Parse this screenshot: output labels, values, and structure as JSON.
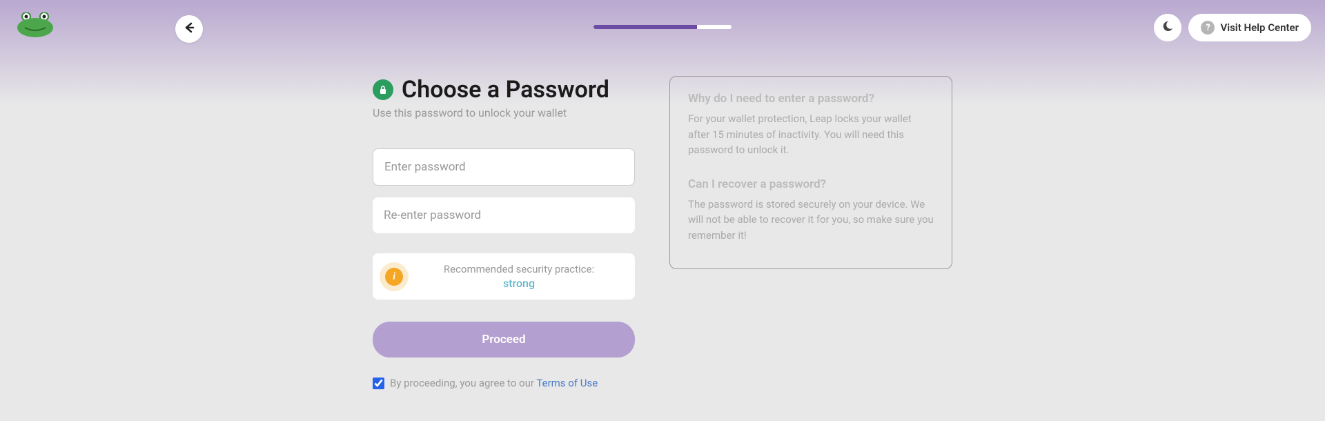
{
  "header": {
    "help_label": "Visit Help Center"
  },
  "form": {
    "title": "Choose a Password",
    "subtitle": "Use this password to unlock your wallet",
    "password_placeholder": "Enter password",
    "confirm_placeholder": "Re-enter password",
    "security_label": "Recommended security practice:",
    "security_strength": "strong",
    "proceed_label": "Proceed",
    "terms_prefix": "By proceeding, you agree to our ",
    "terms_link": "Terms of Use"
  },
  "faq": {
    "q1_title": "Why do I need to enter a password?",
    "q1_body": "For your wallet protection, Leap locks your wallet after 15 minutes of inactivity. You will need this password to unlock it.",
    "q2_title": "Can I recover a password?",
    "q2_body": "The password is stored securely on your device. We will not be able to recover it for you, so make sure you remember it!"
  }
}
